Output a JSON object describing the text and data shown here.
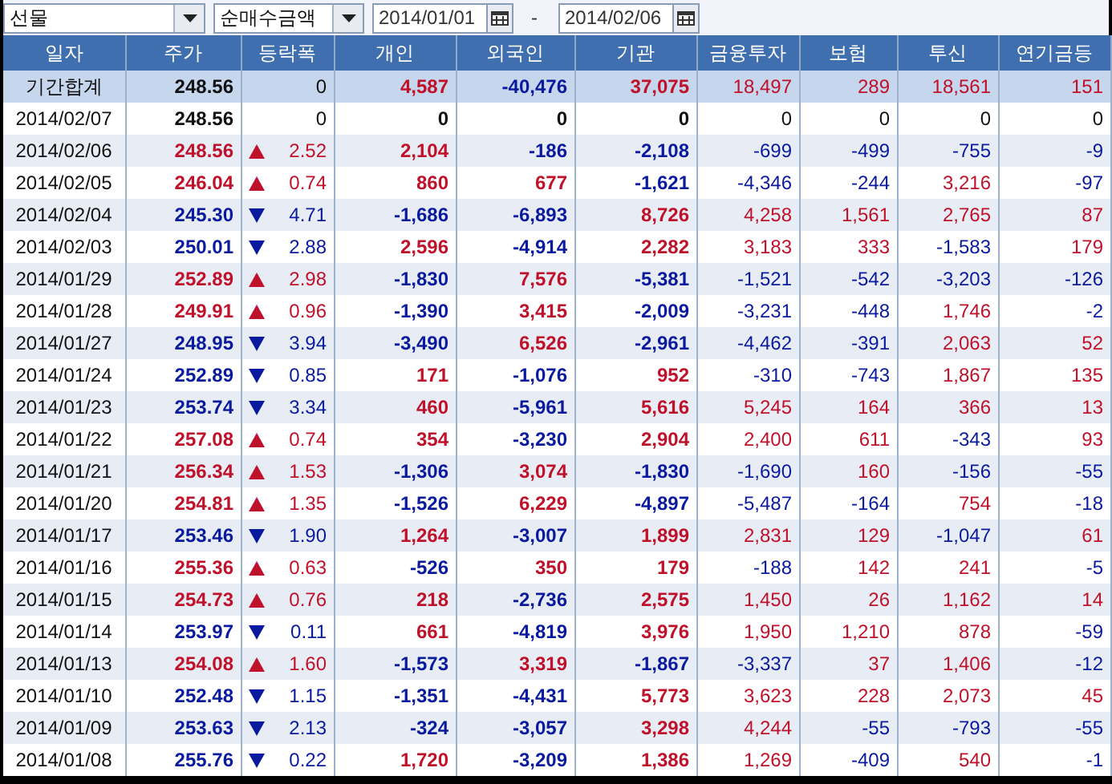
{
  "toolbar": {
    "market": "선물",
    "metric": "순매수금액",
    "start_date": "2014/01/01",
    "separator": "-",
    "end_date": "2014/02/06"
  },
  "columns": [
    "일자",
    "주가",
    "등락폭",
    "개인",
    "외국인",
    "기관",
    "금융투자",
    "보험",
    "투신",
    "연기금등"
  ],
  "rows": [
    {
      "kind": "summary",
      "date": "기간합계",
      "price": "248.56",
      "color": "#111111",
      "change": "0",
      "values": [
        {
          "text": "4,587",
          "color": "#c0112a"
        },
        {
          "text": "-40,476",
          "color": "#0a1a9e"
        },
        {
          "text": "37,075",
          "color": "#c0112a"
        },
        {
          "text": "18,497",
          "color": "#c0112a"
        },
        {
          "text": "289",
          "color": "#c0112a"
        },
        {
          "text": "18,561",
          "color": "#c0112a"
        },
        {
          "text": "151",
          "color": "#c0112a"
        }
      ]
    },
    {
      "kind": "flat",
      "date": "2014/02/07",
      "price": "248.56",
      "color": "#111111",
      "change": "0",
      "values": [
        {
          "text": "0",
          "color": "#111111"
        },
        {
          "text": "0",
          "color": "#111111"
        },
        {
          "text": "0",
          "color": "#111111"
        },
        {
          "text": "0",
          "color": "#111111"
        },
        {
          "text": "0",
          "color": "#111111"
        },
        {
          "text": "0",
          "color": "#111111"
        },
        {
          "text": "0",
          "color": "#111111"
        }
      ]
    },
    {
      "kind": "rise",
      "date": "2014/02/06",
      "price": "248.56",
      "color": "#c0112a",
      "change": "2.52",
      "values": [
        {
          "text": "2,104",
          "color": "#c0112a"
        },
        {
          "text": "-186",
          "color": "#0a1a9e"
        },
        {
          "text": "-2,108",
          "color": "#0a1a9e"
        },
        {
          "text": "-699",
          "color": "#0a1a9e"
        },
        {
          "text": "-499",
          "color": "#0a1a9e"
        },
        {
          "text": "-755",
          "color": "#0a1a9e"
        },
        {
          "text": "-9",
          "color": "#0a1a9e"
        }
      ]
    },
    {
      "kind": "rise",
      "date": "2014/02/05",
      "price": "246.04",
      "color": "#c0112a",
      "change": "0.74",
      "values": [
        {
          "text": "860",
          "color": "#c0112a"
        },
        {
          "text": "677",
          "color": "#c0112a"
        },
        {
          "text": "-1,621",
          "color": "#0a1a9e"
        },
        {
          "text": "-4,346",
          "color": "#0a1a9e"
        },
        {
          "text": "-244",
          "color": "#0a1a9e"
        },
        {
          "text": "3,216",
          "color": "#c0112a"
        },
        {
          "text": "-97",
          "color": "#0a1a9e"
        }
      ]
    },
    {
      "kind": "fall",
      "date": "2014/02/04",
      "price": "245.30",
      "color": "#0a1a9e",
      "change": "4.71",
      "values": [
        {
          "text": "-1,686",
          "color": "#0a1a9e"
        },
        {
          "text": "-6,893",
          "color": "#0a1a9e"
        },
        {
          "text": "8,726",
          "color": "#c0112a"
        },
        {
          "text": "4,258",
          "color": "#c0112a"
        },
        {
          "text": "1,561",
          "color": "#c0112a"
        },
        {
          "text": "2,765",
          "color": "#c0112a"
        },
        {
          "text": "87",
          "color": "#c0112a"
        }
      ]
    },
    {
      "kind": "fall",
      "date": "2014/02/03",
      "price": "250.01",
      "color": "#0a1a9e",
      "change": "2.88",
      "values": [
        {
          "text": "2,596",
          "color": "#c0112a"
        },
        {
          "text": "-4,914",
          "color": "#0a1a9e"
        },
        {
          "text": "2,282",
          "color": "#c0112a"
        },
        {
          "text": "3,183",
          "color": "#c0112a"
        },
        {
          "text": "333",
          "color": "#c0112a"
        },
        {
          "text": "-1,583",
          "color": "#0a1a9e"
        },
        {
          "text": "179",
          "color": "#c0112a"
        }
      ]
    },
    {
      "kind": "rise",
      "date": "2014/01/29",
      "price": "252.89",
      "color": "#c0112a",
      "change": "2.98",
      "values": [
        {
          "text": "-1,830",
          "color": "#0a1a9e"
        },
        {
          "text": "7,576",
          "color": "#c0112a"
        },
        {
          "text": "-5,381",
          "color": "#0a1a9e"
        },
        {
          "text": "-1,521",
          "color": "#0a1a9e"
        },
        {
          "text": "-542",
          "color": "#0a1a9e"
        },
        {
          "text": "-3,203",
          "color": "#0a1a9e"
        },
        {
          "text": "-126",
          "color": "#0a1a9e"
        }
      ]
    },
    {
      "kind": "rise",
      "date": "2014/01/28",
      "price": "249.91",
      "color": "#c0112a",
      "change": "0.96",
      "values": [
        {
          "text": "-1,390",
          "color": "#0a1a9e"
        },
        {
          "text": "3,415",
          "color": "#c0112a"
        },
        {
          "text": "-2,009",
          "color": "#0a1a9e"
        },
        {
          "text": "-3,231",
          "color": "#0a1a9e"
        },
        {
          "text": "-448",
          "color": "#0a1a9e"
        },
        {
          "text": "1,746",
          "color": "#c0112a"
        },
        {
          "text": "-2",
          "color": "#0a1a9e"
        }
      ]
    },
    {
      "kind": "fall",
      "date": "2014/01/27",
      "price": "248.95",
      "color": "#0a1a9e",
      "change": "3.94",
      "values": [
        {
          "text": "-3,490",
          "color": "#0a1a9e"
        },
        {
          "text": "6,526",
          "color": "#c0112a"
        },
        {
          "text": "-2,961",
          "color": "#0a1a9e"
        },
        {
          "text": "-4,462",
          "color": "#0a1a9e"
        },
        {
          "text": "-391",
          "color": "#0a1a9e"
        },
        {
          "text": "2,063",
          "color": "#c0112a"
        },
        {
          "text": "52",
          "color": "#c0112a"
        }
      ]
    },
    {
      "kind": "fall",
      "date": "2014/01/24",
      "price": "252.89",
      "color": "#0a1a9e",
      "change": "0.85",
      "values": [
        {
          "text": "171",
          "color": "#c0112a"
        },
        {
          "text": "-1,076",
          "color": "#0a1a9e"
        },
        {
          "text": "952",
          "color": "#c0112a"
        },
        {
          "text": "-310",
          "color": "#0a1a9e"
        },
        {
          "text": "-743",
          "color": "#0a1a9e"
        },
        {
          "text": "1,867",
          "color": "#c0112a"
        },
        {
          "text": "135",
          "color": "#c0112a"
        }
      ]
    },
    {
      "kind": "fall",
      "date": "2014/01/23",
      "price": "253.74",
      "color": "#0a1a9e",
      "change": "3.34",
      "values": [
        {
          "text": "460",
          "color": "#c0112a"
        },
        {
          "text": "-5,961",
          "color": "#0a1a9e"
        },
        {
          "text": "5,616",
          "color": "#c0112a"
        },
        {
          "text": "5,245",
          "color": "#c0112a"
        },
        {
          "text": "164",
          "color": "#c0112a"
        },
        {
          "text": "366",
          "color": "#c0112a"
        },
        {
          "text": "13",
          "color": "#c0112a"
        }
      ]
    },
    {
      "kind": "rise",
      "date": "2014/01/22",
      "price": "257.08",
      "color": "#c0112a",
      "change": "0.74",
      "values": [
        {
          "text": "354",
          "color": "#c0112a"
        },
        {
          "text": "-3,230",
          "color": "#0a1a9e"
        },
        {
          "text": "2,904",
          "color": "#c0112a"
        },
        {
          "text": "2,400",
          "color": "#c0112a"
        },
        {
          "text": "611",
          "color": "#c0112a"
        },
        {
          "text": "-343",
          "color": "#0a1a9e"
        },
        {
          "text": "93",
          "color": "#c0112a"
        }
      ]
    },
    {
      "kind": "rise",
      "date": "2014/01/21",
      "price": "256.34",
      "color": "#c0112a",
      "change": "1.53",
      "values": [
        {
          "text": "-1,306",
          "color": "#0a1a9e"
        },
        {
          "text": "3,074",
          "color": "#c0112a"
        },
        {
          "text": "-1,830",
          "color": "#0a1a9e"
        },
        {
          "text": "-1,690",
          "color": "#0a1a9e"
        },
        {
          "text": "160",
          "color": "#c0112a"
        },
        {
          "text": "-156",
          "color": "#0a1a9e"
        },
        {
          "text": "-55",
          "color": "#0a1a9e"
        }
      ]
    },
    {
      "kind": "rise",
      "date": "2014/01/20",
      "price": "254.81",
      "color": "#c0112a",
      "change": "1.35",
      "values": [
        {
          "text": "-1,526",
          "color": "#0a1a9e"
        },
        {
          "text": "6,229",
          "color": "#c0112a"
        },
        {
          "text": "-4,897",
          "color": "#0a1a9e"
        },
        {
          "text": "-5,487",
          "color": "#0a1a9e"
        },
        {
          "text": "-164",
          "color": "#0a1a9e"
        },
        {
          "text": "754",
          "color": "#c0112a"
        },
        {
          "text": "-18",
          "color": "#0a1a9e"
        }
      ]
    },
    {
      "kind": "fall",
      "date": "2014/01/17",
      "price": "253.46",
      "color": "#0a1a9e",
      "change": "1.90",
      "values": [
        {
          "text": "1,264",
          "color": "#c0112a"
        },
        {
          "text": "-3,007",
          "color": "#0a1a9e"
        },
        {
          "text": "1,899",
          "color": "#c0112a"
        },
        {
          "text": "2,831",
          "color": "#c0112a"
        },
        {
          "text": "129",
          "color": "#c0112a"
        },
        {
          "text": "-1,047",
          "color": "#0a1a9e"
        },
        {
          "text": "61",
          "color": "#c0112a"
        }
      ]
    },
    {
      "kind": "rise",
      "date": "2014/01/16",
      "price": "255.36",
      "color": "#c0112a",
      "change": "0.63",
      "values": [
        {
          "text": "-526",
          "color": "#0a1a9e"
        },
        {
          "text": "350",
          "color": "#c0112a"
        },
        {
          "text": "179",
          "color": "#c0112a"
        },
        {
          "text": "-188",
          "color": "#0a1a9e"
        },
        {
          "text": "142",
          "color": "#c0112a"
        },
        {
          "text": "241",
          "color": "#c0112a"
        },
        {
          "text": "-5",
          "color": "#0a1a9e"
        }
      ]
    },
    {
      "kind": "rise",
      "date": "2014/01/15",
      "price": "254.73",
      "color": "#c0112a",
      "change": "0.76",
      "values": [
        {
          "text": "218",
          "color": "#c0112a"
        },
        {
          "text": "-2,736",
          "color": "#0a1a9e"
        },
        {
          "text": "2,575",
          "color": "#c0112a"
        },
        {
          "text": "1,450",
          "color": "#c0112a"
        },
        {
          "text": "26",
          "color": "#c0112a"
        },
        {
          "text": "1,162",
          "color": "#c0112a"
        },
        {
          "text": "14",
          "color": "#c0112a"
        }
      ]
    },
    {
      "kind": "fall",
      "date": "2014/01/14",
      "price": "253.97",
      "color": "#0a1a9e",
      "change": "0.11",
      "values": [
        {
          "text": "661",
          "color": "#c0112a"
        },
        {
          "text": "-4,819",
          "color": "#0a1a9e"
        },
        {
          "text": "3,976",
          "color": "#c0112a"
        },
        {
          "text": "1,950",
          "color": "#c0112a"
        },
        {
          "text": "1,210",
          "color": "#c0112a"
        },
        {
          "text": "878",
          "color": "#c0112a"
        },
        {
          "text": "-59",
          "color": "#0a1a9e"
        }
      ]
    },
    {
      "kind": "rise",
      "date": "2014/01/13",
      "price": "254.08",
      "color": "#c0112a",
      "change": "1.60",
      "values": [
        {
          "text": "-1,573",
          "color": "#0a1a9e"
        },
        {
          "text": "3,319",
          "color": "#c0112a"
        },
        {
          "text": "-1,867",
          "color": "#0a1a9e"
        },
        {
          "text": "-3,337",
          "color": "#0a1a9e"
        },
        {
          "text": "37",
          "color": "#c0112a"
        },
        {
          "text": "1,406",
          "color": "#c0112a"
        },
        {
          "text": "-12",
          "color": "#0a1a9e"
        }
      ]
    },
    {
      "kind": "fall",
      "date": "2014/01/10",
      "price": "252.48",
      "color": "#0a1a9e",
      "change": "1.15",
      "values": [
        {
          "text": "-1,351",
          "color": "#0a1a9e"
        },
        {
          "text": "-4,431",
          "color": "#0a1a9e"
        },
        {
          "text": "5,773",
          "color": "#c0112a"
        },
        {
          "text": "3,623",
          "color": "#c0112a"
        },
        {
          "text": "228",
          "color": "#c0112a"
        },
        {
          "text": "2,073",
          "color": "#c0112a"
        },
        {
          "text": "45",
          "color": "#c0112a"
        }
      ]
    },
    {
      "kind": "fall",
      "date": "2014/01/09",
      "price": "253.63",
      "color": "#0a1a9e",
      "change": "2.13",
      "values": [
        {
          "text": "-324",
          "color": "#0a1a9e"
        },
        {
          "text": "-3,057",
          "color": "#0a1a9e"
        },
        {
          "text": "3,298",
          "color": "#c0112a"
        },
        {
          "text": "4,244",
          "color": "#c0112a"
        },
        {
          "text": "-55",
          "color": "#0a1a9e"
        },
        {
          "text": "-793",
          "color": "#0a1a9e"
        },
        {
          "text": "-55",
          "color": "#0a1a9e"
        }
      ]
    },
    {
      "kind": "fall",
      "date": "2014/01/08",
      "price": "255.76",
      "color": "#0a1a9e",
      "change": "0.22",
      "values": [
        {
          "text": "1,720",
          "color": "#c0112a"
        },
        {
          "text": "-3,209",
          "color": "#0a1a9e"
        },
        {
          "text": "1,386",
          "color": "#c0112a"
        },
        {
          "text": "1,269",
          "color": "#c0112a"
        },
        {
          "text": "-409",
          "color": "#0a1a9e"
        },
        {
          "text": "540",
          "color": "#c0112a"
        },
        {
          "text": "-1",
          "color": "#0a1a9e"
        }
      ]
    }
  ]
}
